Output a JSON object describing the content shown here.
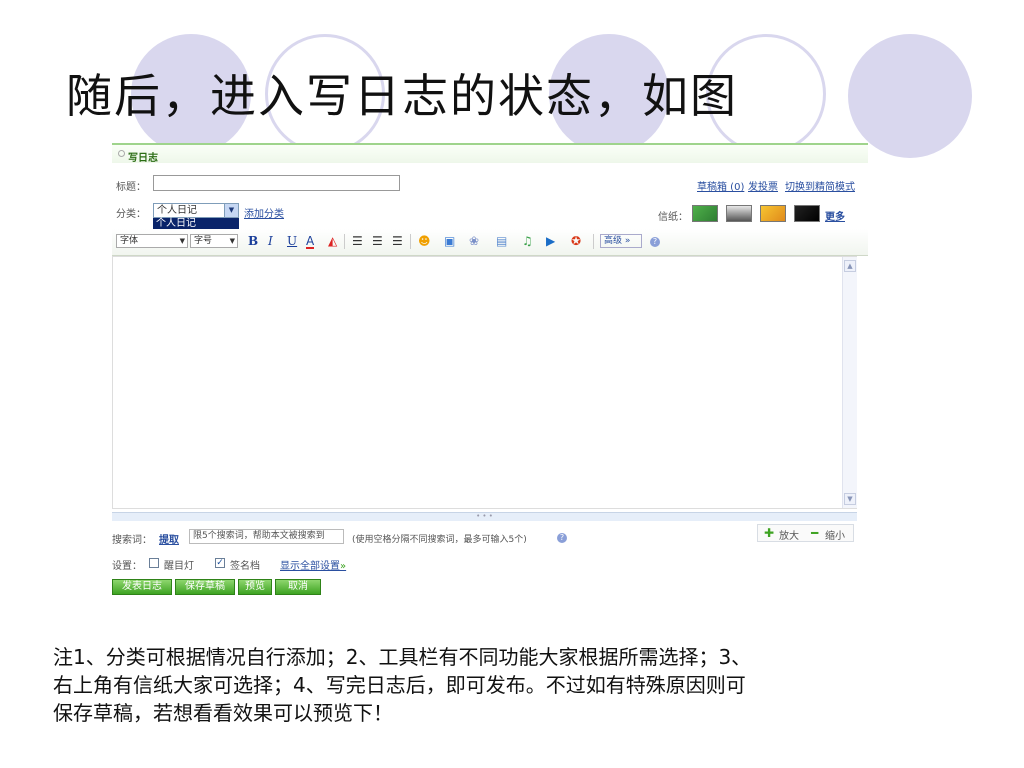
{
  "slide": {
    "title": "随后，进入写日志的状态，如图",
    "note_lines": [
      "注1、分类可根据情况自行添加；2、工具栏有不同功能大家根据所需选择；3、",
      "右上角有信纸大家可选择；4、写完日志后，即可发布。不过如有特殊原因则可",
      "保存草稿，若想看看效果可以预览下！"
    ]
  },
  "editor_panel": {
    "header_title": "写日志",
    "title_label": "标题：",
    "title_value": "",
    "drafts_link": "草稿箱 (0)",
    "vote_link": "发投票",
    "switch_mode_link": "切换到精简模式",
    "category_label": "分类：",
    "category_selected": "个人日记",
    "category_option_highlighted": "个人日记",
    "add_category_link": "添加分类",
    "stationery_label": "信纸：",
    "more_link": "更多",
    "font_select": "字体",
    "size_select": "字号",
    "format_buttons": {
      "bold": "B",
      "italic": "I",
      "underline": "U",
      "font_color": "A"
    },
    "advanced_label": "高级",
    "keyword_label": "搜索词：",
    "extract_link": "提取",
    "keyword_placeholder": "限5个搜索词，帮助本文被搜索到",
    "keyword_hint": "(使用空格分隔不同搜索词，最多可输入5个)",
    "zoom_in": "放大",
    "zoom_out": "缩小",
    "settings_label": "设置：",
    "eye_light_label": "醒目灯",
    "eye_light_checked": false,
    "signature_label": "签名档",
    "signature_checked": true,
    "show_all_settings_link": "显示全部设置",
    "buttons": {
      "publish": "发表日志",
      "save_draft": "保存草稿",
      "preview": "预览",
      "cancel": "取消"
    }
  },
  "colors": {
    "accent_green": "#3ea322",
    "circle_lavender": "#d9d7ee",
    "link_blue": "#2a4fa0"
  }
}
